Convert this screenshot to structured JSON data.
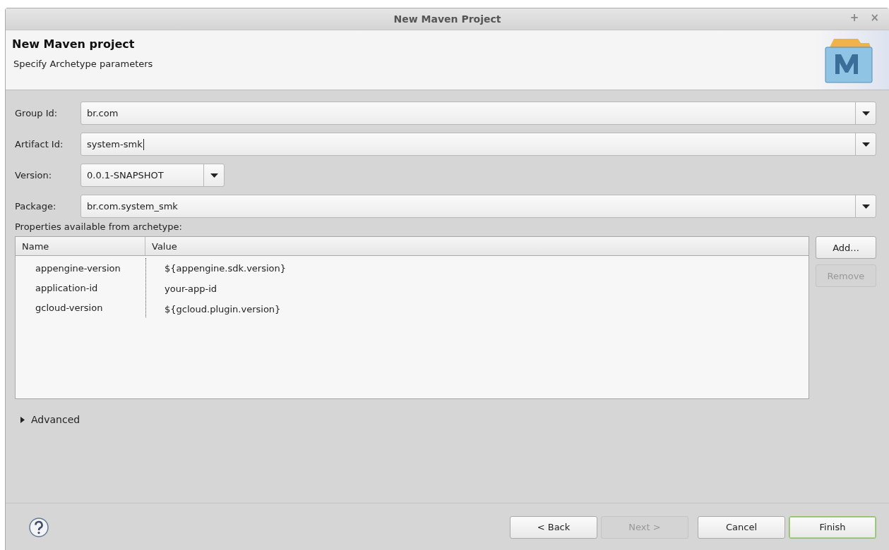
{
  "window": {
    "title": "New Maven Project",
    "controls": [
      "+",
      "×"
    ]
  },
  "header": {
    "title": "New Maven project",
    "subtitle": "Specify Archetype parameters"
  },
  "fields": [
    {
      "label": "Group Id:",
      "value": "br.com",
      "kind": "wide",
      "focused": false
    },
    {
      "label": "Artifact Id:",
      "value": "system-smk",
      "kind": "wide",
      "focused": true
    },
    {
      "label": "Version:",
      "value": "0.0.1-SNAPSHOT",
      "kind": "short",
      "focused": false
    },
    {
      "label": "Package:",
      "value": "br.com.system_smk",
      "kind": "wide",
      "focused": false
    }
  ],
  "properties": {
    "label": "Properties available from archetype:",
    "columns": [
      "Name",
      "Value"
    ],
    "rows": [
      [
        "appengine-version",
        "${appengine.sdk.version}"
      ],
      [
        "application-id",
        "your-app-id"
      ],
      [
        "gcloud-version",
        "${gcloud.plugin.version}"
      ]
    ],
    "buttons": [
      {
        "label": "Add...",
        "disabled": false
      },
      {
        "label": "Remove",
        "disabled": true
      }
    ]
  },
  "advanced": {
    "label": "Advanced",
    "expanded": false
  },
  "buttons": [
    {
      "label": "< Back",
      "disabled": false,
      "default": false
    },
    {
      "label": "Next >",
      "disabled": true,
      "default": false
    },
    {
      "label": "Cancel",
      "disabled": false,
      "default": false
    },
    {
      "label": "Finish",
      "disabled": false,
      "default": true
    }
  ]
}
